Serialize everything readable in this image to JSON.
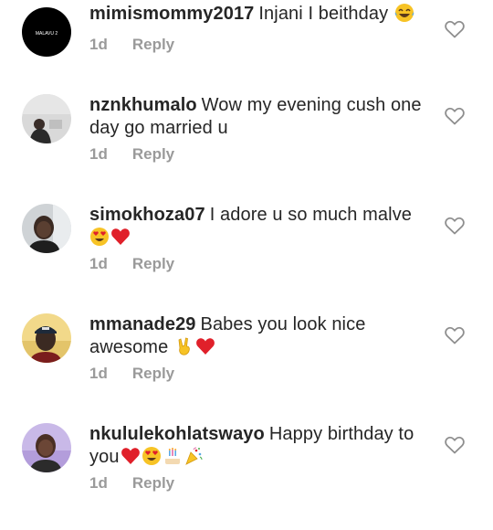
{
  "comments": [
    {
      "username": "mimismommy2017",
      "text": "Injani I beithday",
      "emojis": [
        "tears-of-joy-emoji"
      ],
      "time": "1d",
      "reply": "Reply",
      "avatar": "black-logo-avatar",
      "avatar_text": "MALAVU 2"
    },
    {
      "username": "nznkhumalo",
      "text": "Wow my evening cush one day go married u",
      "emojis": [],
      "time": "1d",
      "reply": "Reply",
      "avatar": "man-photo-avatar"
    },
    {
      "username": "simokhoza07",
      "text": "I adore u so much malve",
      "emojis": [
        "heart-eyes-emoji",
        "red-heart-emoji"
      ],
      "time": "1d",
      "reply": "Reply",
      "avatar": "man-photo-avatar"
    },
    {
      "username": "mmanade29",
      "text": "Babes you look nice awesome",
      "emojis": [
        "victory-hand-emoji",
        "red-heart-emoji"
      ],
      "time": "1d",
      "reply": "Reply",
      "avatar": "man-cap-photo-avatar"
    },
    {
      "username": "nkululekohlatswayo",
      "text": "Happy birthday to you",
      "emojis": [
        "red-heart-emoji",
        "heart-eyes-emoji",
        "birthday-cake-emoji",
        "party-popper-emoji"
      ],
      "time": "1d",
      "reply": "Reply",
      "avatar": "man-photo-avatar"
    }
  ],
  "colors": {
    "username": "#262626",
    "meta": "#9a9a9a",
    "heart_outline": "#8e8e8e",
    "red_heart": "#e0202a",
    "emoji_yellow": "#f7c325"
  }
}
